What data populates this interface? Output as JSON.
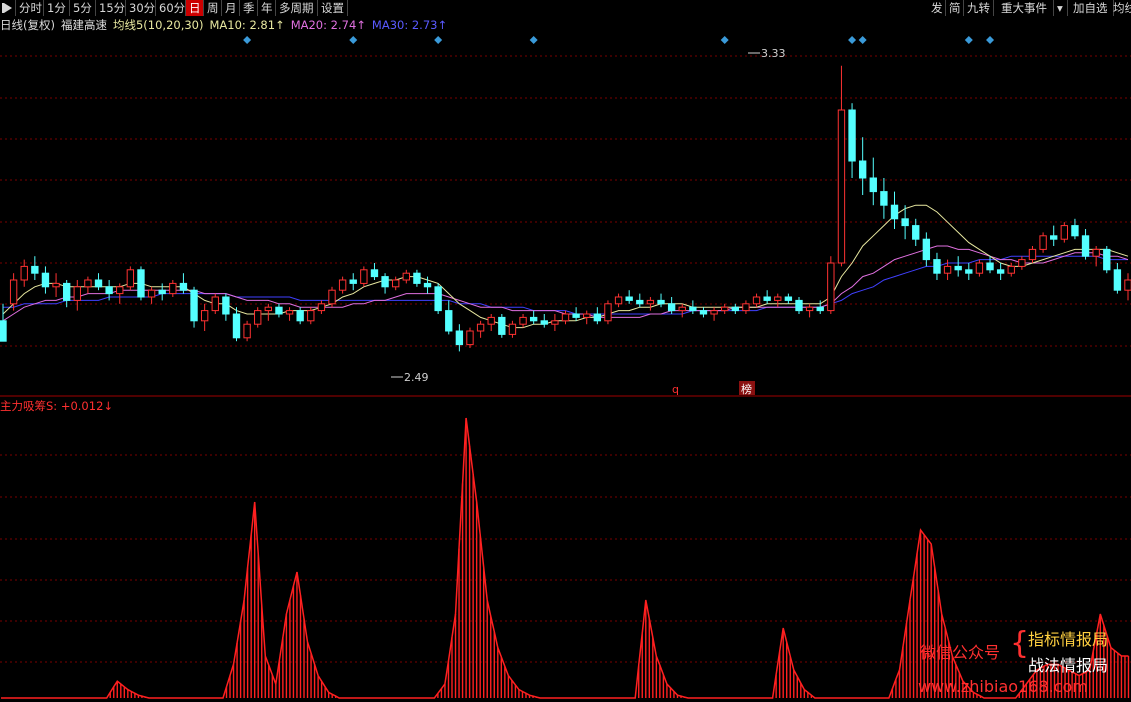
{
  "toolbar": {
    "items": [
      "分时",
      "1分",
      "5分",
      "15分",
      "30分",
      "60分",
      "日",
      "周",
      "月",
      "季",
      "年",
      "多周期",
      "设置"
    ],
    "active_index": 6,
    "right_items": [
      "发",
      "简",
      "九转",
      "重大事件",
      "加自选",
      "均线"
    ]
  },
  "header": {
    "period": "日线(复权)",
    "stock_name": "福建高速",
    "ma_name": "均线5(10,20,30)",
    "ma10": "MA10: 2.81↑",
    "ma20": "MA20: 2.74↑",
    "ma30": "MA30: 2.73↑"
  },
  "price_panel": {
    "high_label": "3.33",
    "low_label": "2.49",
    "event_q": "q",
    "event_bang": "榜"
  },
  "indicator": {
    "label": "主力吸筹S: +0.012↓"
  },
  "watermark": {
    "left": "微信公众号",
    "brace": "{",
    "top": "指标情报局",
    "bottom": "战法情报局",
    "url": "www.zhibiao168.com"
  },
  "colors": {
    "up": "#ff3232",
    "down": "#54ffff",
    "ma10": "#e8e8a0",
    "ma20": "#e070e0",
    "ma30": "#4040ff",
    "grid": "#7a0000",
    "indicator": "#ff2020"
  },
  "chart_data": {
    "type": "candlestick",
    "price_range": [
      2.4,
      3.4
    ],
    "candles": [
      [
        2.58,
        2.63,
        2.55,
        2.52
      ],
      [
        2.63,
        2.72,
        2.61,
        2.7
      ],
      [
        2.7,
        2.76,
        2.68,
        2.74
      ],
      [
        2.74,
        2.77,
        2.7,
        2.72
      ],
      [
        2.72,
        2.74,
        2.66,
        2.68
      ],
      [
        2.68,
        2.72,
        2.65,
        2.69
      ],
      [
        2.69,
        2.7,
        2.62,
        2.64
      ],
      [
        2.64,
        2.7,
        2.61,
        2.68
      ],
      [
        2.68,
        2.71,
        2.66,
        2.7
      ],
      [
        2.7,
        2.72,
        2.67,
        2.68
      ],
      [
        2.68,
        2.7,
        2.64,
        2.66
      ],
      [
        2.66,
        2.69,
        2.63,
        2.68
      ],
      [
        2.68,
        2.74,
        2.67,
        2.73
      ],
      [
        2.73,
        2.74,
        2.64,
        2.65
      ],
      [
        2.65,
        2.68,
        2.63,
        2.67
      ],
      [
        2.67,
        2.69,
        2.64,
        2.66
      ],
      [
        2.66,
        2.7,
        2.65,
        2.69
      ],
      [
        2.69,
        2.72,
        2.66,
        2.67
      ],
      [
        2.67,
        2.68,
        2.56,
        2.58
      ],
      [
        2.58,
        2.63,
        2.55,
        2.61
      ],
      [
        2.61,
        2.66,
        2.6,
        2.65
      ],
      [
        2.65,
        2.66,
        2.58,
        2.6
      ],
      [
        2.6,
        2.62,
        2.52,
        2.53
      ],
      [
        2.53,
        2.58,
        2.52,
        2.57
      ],
      [
        2.57,
        2.62,
        2.56,
        2.61
      ],
      [
        2.61,
        2.63,
        2.58,
        2.62
      ],
      [
        2.62,
        2.63,
        2.59,
        2.6
      ],
      [
        2.6,
        2.62,
        2.58,
        2.61
      ],
      [
        2.61,
        2.62,
        2.57,
        2.58
      ],
      [
        2.58,
        2.62,
        2.57,
        2.61
      ],
      [
        2.61,
        2.64,
        2.6,
        2.63
      ],
      [
        2.63,
        2.68,
        2.62,
        2.67
      ],
      [
        2.67,
        2.71,
        2.66,
        2.7
      ],
      [
        2.7,
        2.72,
        2.67,
        2.69
      ],
      [
        2.69,
        2.74,
        2.68,
        2.73
      ],
      [
        2.73,
        2.75,
        2.7,
        2.71
      ],
      [
        2.71,
        2.72,
        2.66,
        2.68
      ],
      [
        2.68,
        2.71,
        2.67,
        2.7
      ],
      [
        2.7,
        2.73,
        2.69,
        2.72
      ],
      [
        2.72,
        2.73,
        2.68,
        2.69
      ],
      [
        2.69,
        2.71,
        2.66,
        2.68
      ],
      [
        2.68,
        2.69,
        2.6,
        2.61
      ],
      [
        2.61,
        2.64,
        2.54,
        2.55
      ],
      [
        2.55,
        2.57,
        2.49,
        2.51
      ],
      [
        2.51,
        2.56,
        2.5,
        2.55
      ],
      [
        2.55,
        2.58,
        2.53,
        2.57
      ],
      [
        2.57,
        2.6,
        2.55,
        2.59
      ],
      [
        2.59,
        2.6,
        2.53,
        2.54
      ],
      [
        2.54,
        2.58,
        2.53,
        2.57
      ],
      [
        2.57,
        2.6,
        2.56,
        2.59
      ],
      [
        2.59,
        2.61,
        2.57,
        2.58
      ],
      [
        2.58,
        2.6,
        2.56,
        2.57
      ],
      [
        2.57,
        2.6,
        2.55,
        2.58
      ],
      [
        2.58,
        2.61,
        2.57,
        2.6
      ],
      [
        2.6,
        2.62,
        2.58,
        2.59
      ],
      [
        2.59,
        2.61,
        2.57,
        2.6
      ],
      [
        2.6,
        2.62,
        2.57,
        2.58
      ],
      [
        2.58,
        2.64,
        2.57,
        2.63
      ],
      [
        2.63,
        2.66,
        2.62,
        2.65
      ],
      [
        2.65,
        2.67,
        2.63,
        2.64
      ],
      [
        2.64,
        2.66,
        2.62,
        2.63
      ],
      [
        2.63,
        2.65,
        2.61,
        2.64
      ],
      [
        2.64,
        2.66,
        2.62,
        2.63
      ],
      [
        2.63,
        2.65,
        2.6,
        2.61
      ],
      [
        2.61,
        2.63,
        2.59,
        2.62
      ],
      [
        2.62,
        2.64,
        2.6,
        2.61
      ],
      [
        2.61,
        2.62,
        2.59,
        2.6
      ],
      [
        2.6,
        2.62,
        2.58,
        2.61
      ],
      [
        2.61,
        2.63,
        2.6,
        2.62
      ],
      [
        2.62,
        2.63,
        2.6,
        2.61
      ],
      [
        2.61,
        2.64,
        2.6,
        2.63
      ],
      [
        2.63,
        2.66,
        2.62,
        2.65
      ],
      [
        2.65,
        2.67,
        2.63,
        2.64
      ],
      [
        2.64,
        2.66,
        2.62,
        2.65
      ],
      [
        2.65,
        2.66,
        2.63,
        2.64
      ],
      [
        2.64,
        2.65,
        2.6,
        2.61
      ],
      [
        2.61,
        2.63,
        2.59,
        2.62
      ],
      [
        2.62,
        2.64,
        2.6,
        2.61
      ],
      [
        2.61,
        2.77,
        2.6,
        2.75
      ],
      [
        2.75,
        3.33,
        2.74,
        3.2
      ],
      [
        3.2,
        3.22,
        3.0,
        3.05
      ],
      [
        3.05,
        3.12,
        2.95,
        3.0
      ],
      [
        3.0,
        3.06,
        2.92,
        2.96
      ],
      [
        2.96,
        3.0,
        2.88,
        2.92
      ],
      [
        2.92,
        2.96,
        2.85,
        2.88
      ],
      [
        2.88,
        2.92,
        2.82,
        2.86
      ],
      [
        2.86,
        2.88,
        2.8,
        2.82
      ],
      [
        2.82,
        2.84,
        2.74,
        2.76
      ],
      [
        2.76,
        2.78,
        2.7,
        2.72
      ],
      [
        2.72,
        2.76,
        2.7,
        2.74
      ],
      [
        2.74,
        2.77,
        2.71,
        2.73
      ],
      [
        2.73,
        2.75,
        2.7,
        2.72
      ],
      [
        2.72,
        2.76,
        2.71,
        2.75
      ],
      [
        2.75,
        2.77,
        2.72,
        2.73
      ],
      [
        2.73,
        2.75,
        2.7,
        2.72
      ],
      [
        2.72,
        2.75,
        2.71,
        2.74
      ],
      [
        2.74,
        2.77,
        2.73,
        2.76
      ],
      [
        2.76,
        2.8,
        2.75,
        2.79
      ],
      [
        2.79,
        2.84,
        2.78,
        2.83
      ],
      [
        2.83,
        2.86,
        2.8,
        2.82
      ],
      [
        2.82,
        2.87,
        2.81,
        2.86
      ],
      [
        2.86,
        2.88,
        2.82,
        2.83
      ],
      [
        2.83,
        2.85,
        2.76,
        2.77
      ],
      [
        2.77,
        2.8,
        2.74,
        2.79
      ],
      [
        2.79,
        2.8,
        2.72,
        2.73
      ],
      [
        2.73,
        2.75,
        2.66,
        2.67
      ],
      [
        2.67,
        2.72,
        2.64,
        2.7
      ]
    ],
    "ma10": [
      2.6,
      2.63,
      2.66,
      2.68,
      2.69,
      2.69,
      2.68,
      2.68,
      2.68,
      2.68,
      2.68,
      2.68,
      2.69,
      2.69,
      2.68,
      2.68,
      2.68,
      2.68,
      2.66,
      2.64,
      2.63,
      2.63,
      2.61,
      2.6,
      2.6,
      2.6,
      2.6,
      2.61,
      2.61,
      2.61,
      2.62,
      2.63,
      2.65,
      2.66,
      2.68,
      2.69,
      2.7,
      2.7,
      2.71,
      2.71,
      2.7,
      2.69,
      2.66,
      2.63,
      2.61,
      2.59,
      2.58,
      2.57,
      2.56,
      2.56,
      2.57,
      2.57,
      2.58,
      2.58,
      2.58,
      2.59,
      2.59,
      2.6,
      2.61,
      2.61,
      2.62,
      2.62,
      2.63,
      2.63,
      2.63,
      2.62,
      2.62,
      2.62,
      2.62,
      2.62,
      2.62,
      2.62,
      2.63,
      2.63,
      2.63,
      2.63,
      2.63,
      2.63,
      2.65,
      2.71,
      2.75,
      2.8,
      2.83,
      2.86,
      2.89,
      2.91,
      2.92,
      2.92,
      2.9,
      2.87,
      2.84,
      2.81,
      2.79,
      2.77,
      2.75,
      2.74,
      2.74,
      2.75,
      2.76,
      2.77,
      2.78,
      2.79,
      2.79,
      2.79,
      2.79,
      2.78,
      2.77
    ],
    "ma20": [
      2.58,
      2.6,
      2.62,
      2.63,
      2.64,
      2.64,
      2.65,
      2.65,
      2.66,
      2.66,
      2.66,
      2.67,
      2.67,
      2.67,
      2.67,
      2.67,
      2.67,
      2.67,
      2.67,
      2.66,
      2.66,
      2.66,
      2.65,
      2.64,
      2.64,
      2.64,
      2.63,
      2.63,
      2.62,
      2.62,
      2.62,
      2.62,
      2.62,
      2.63,
      2.63,
      2.64,
      2.64,
      2.65,
      2.66,
      2.66,
      2.66,
      2.66,
      2.65,
      2.64,
      2.63,
      2.62,
      2.62,
      2.62,
      2.61,
      2.61,
      2.61,
      2.61,
      2.61,
      2.6,
      2.6,
      2.6,
      2.59,
      2.59,
      2.59,
      2.59,
      2.59,
      2.6,
      2.6,
      2.61,
      2.61,
      2.61,
      2.61,
      2.61,
      2.61,
      2.62,
      2.62,
      2.62,
      2.62,
      2.62,
      2.62,
      2.62,
      2.62,
      2.62,
      2.63,
      2.66,
      2.68,
      2.71,
      2.72,
      2.74,
      2.76,
      2.77,
      2.78,
      2.79,
      2.8,
      2.8,
      2.79,
      2.79,
      2.78,
      2.77,
      2.76,
      2.76,
      2.75,
      2.75,
      2.75,
      2.76,
      2.77,
      2.78,
      2.78,
      2.78,
      2.77,
      2.77,
      2.76
    ],
    "ma30": [
      2.62,
      2.62,
      2.63,
      2.63,
      2.63,
      2.63,
      2.64,
      2.64,
      2.64,
      2.64,
      2.65,
      2.65,
      2.65,
      2.65,
      2.65,
      2.66,
      2.66,
      2.66,
      2.66,
      2.66,
      2.66,
      2.66,
      2.65,
      2.65,
      2.65,
      2.65,
      2.65,
      2.65,
      2.64,
      2.64,
      2.64,
      2.64,
      2.64,
      2.64,
      2.64,
      2.64,
      2.64,
      2.64,
      2.64,
      2.64,
      2.64,
      2.64,
      2.64,
      2.63,
      2.63,
      2.63,
      2.62,
      2.62,
      2.62,
      2.62,
      2.61,
      2.61,
      2.61,
      2.61,
      2.6,
      2.6,
      2.6,
      2.6,
      2.6,
      2.6,
      2.6,
      2.6,
      2.6,
      2.6,
      2.6,
      2.61,
      2.61,
      2.61,
      2.61,
      2.61,
      2.61,
      2.61,
      2.62,
      2.62,
      2.62,
      2.62,
      2.62,
      2.62,
      2.63,
      2.64,
      2.66,
      2.67,
      2.68,
      2.7,
      2.71,
      2.72,
      2.73,
      2.74,
      2.74,
      2.75,
      2.75,
      2.75,
      2.76,
      2.76,
      2.76,
      2.77,
      2.77,
      2.77,
      2.77,
      2.77,
      2.77,
      2.77,
      2.77,
      2.77,
      2.76,
      2.76,
      2.76
    ],
    "indicator_values": [
      0,
      0,
      0,
      0,
      0,
      0,
      0,
      0,
      0,
      0,
      0,
      0.06,
      0.03,
      0.01,
      0,
      0,
      0,
      0,
      0,
      0,
      0,
      0,
      0.12,
      0.35,
      0.7,
      0.15,
      0.05,
      0.3,
      0.45,
      0.2,
      0.08,
      0.02,
      0,
      0,
      0,
      0,
      0,
      0,
      0,
      0,
      0,
      0,
      0.05,
      0.3,
      1.0,
      0.7,
      0.35,
      0.18,
      0.08,
      0.03,
      0.01,
      0,
      0,
      0,
      0,
      0,
      0,
      0,
      0,
      0,
      0,
      0.35,
      0.15,
      0.05,
      0.01,
      0,
      0,
      0,
      0,
      0,
      0,
      0,
      0,
      0,
      0.25,
      0.1,
      0.03,
      0,
      0,
      0,
      0,
      0,
      0,
      0,
      0,
      0.1,
      0.35,
      0.6,
      0.55,
      0.3,
      0.15,
      0.06,
      0.02,
      0,
      0,
      0,
      0,
      0.05,
      0.1,
      0.12,
      0.12,
      0.1,
      0.08,
      0.1,
      0.3,
      0.18,
      0.15
    ],
    "diamond_indices": [
      23,
      33,
      41,
      50,
      68,
      80,
      81,
      91,
      93
    ]
  }
}
